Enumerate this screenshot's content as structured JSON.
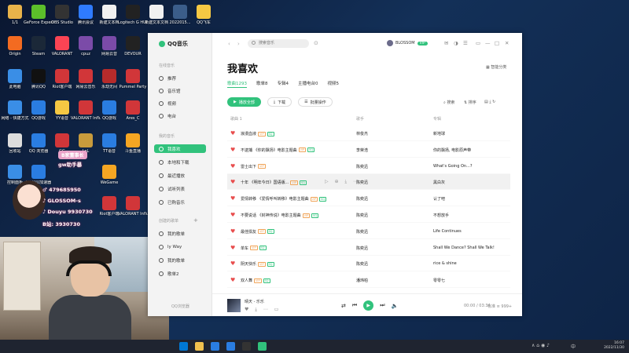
{
  "desktop": {
    "icons": [
      {
        "label": "1/1",
        "color": "#e8b34a"
      },
      {
        "label": "GeForce Experience",
        "color": "#5cbf2a"
      },
      {
        "label": "OBS Studio",
        "color": "#333333"
      },
      {
        "label": "腾讯会议",
        "color": "#2f7bff"
      },
      {
        "label": "新建文本档",
        "color": "#f0f0f0"
      },
      {
        "label": "Logitech G HUB",
        "color": "#222222"
      },
      {
        "label": "新建文本文档",
        "color": "#f0f0f0"
      },
      {
        "label": "2022015...",
        "color": "#3b5d8a"
      },
      {
        "label": "QQ飞车",
        "color": "#f5c843"
      },
      {
        "label": "Origin",
        "color": "#f36b21"
      },
      {
        "label": "Steam",
        "color": "#1b2838"
      },
      {
        "label": "VALORANT",
        "color": "#fa4454"
      },
      {
        "label": "cpuz",
        "color": "#7b4ba8"
      },
      {
        "label": "网易云音",
        "color": "#7b4ba8"
      },
      {
        "label": "DEVOUR",
        "color": "#222222"
      },
      {
        "label": "此电脑",
        "color": "#3a8ee6"
      },
      {
        "label": "腾讯QQ",
        "color": "#111111"
      },
      {
        "label": "Riot客户端",
        "color": "#d13639"
      },
      {
        "label": "网易云音乐",
        "color": "#d13639"
      },
      {
        "label": "永劫无间",
        "color": "#b62b2b"
      },
      {
        "label": "Pummel Party",
        "color": "#d13639"
      },
      {
        "label": "网络 - 快捷方式",
        "color": "#3a8ee6"
      },
      {
        "label": "QQ游戏",
        "color": "#2a7de1"
      },
      {
        "label": "YY语音",
        "color": "#f5c843"
      },
      {
        "label": "VALORANT Influence...",
        "color": "#d13639"
      },
      {
        "label": "QQ游戏",
        "color": "#2a7de1"
      },
      {
        "label": "Ares_C",
        "color": "#d13639"
      },
      {
        "label": "回收站",
        "color": "#dddddd"
      },
      {
        "label": "QQ 浏览器",
        "color": "#2a7de1"
      },
      {
        "label": "GG",
        "color": "#d13639"
      },
      {
        "label": "LoL",
        "color": "#c89b3c"
      },
      {
        "label": "TT语音",
        "color": "#2a7de1"
      },
      {
        "label": "斗鱼直播",
        "color": "#f5a623"
      },
      {
        "label": "控制面板",
        "color": "#3a8ee6"
      },
      {
        "label": "网易UU加速器",
        "color": "#2a7de1"
      },
      {
        "label": "WeGame",
        "color": "#f5a623"
      },
      {
        "label": "Riot客户端",
        "color": "#d13639"
      },
      {
        "label": "VALORANT Influence...",
        "color": "#d13639"
      }
    ]
  },
  "overlay": {
    "badge": "B家董事长",
    "sub": "gw助手暴",
    "line1": "♂ 479685950",
    "line2": "♪ GLOSSOM-s",
    "line3": "♪ Douyu 9930730",
    "line4": "B站: 3930730"
  },
  "taskbar": {
    "time": "16:07",
    "date": "2022/11/30",
    "lang": "中",
    "tray": "∧ ⌂ ◉ ♪"
  },
  "app": {
    "name": "QQ音乐",
    "search_placeholder": "搜索音乐",
    "username": "BLOSSOM",
    "vip_label": "VIP",
    "sidebar": {
      "online_label": "在线音乐",
      "online": [
        {
          "label": "推荐",
          "icon": "circle-icon"
        },
        {
          "label": "音乐馆",
          "icon": "music-hall-icon"
        },
        {
          "label": "视频",
          "icon": "video-icon"
        },
        {
          "label": "电台",
          "icon": "radio-icon"
        }
      ],
      "my_label": "我的音乐",
      "my": [
        {
          "label": "我喜欢",
          "icon": "heart-icon",
          "active": true
        },
        {
          "label": "本地和下载",
          "icon": "download-icon"
        },
        {
          "label": "最近播放",
          "icon": "clock-icon"
        },
        {
          "label": "试听列表",
          "icon": "list-icon"
        },
        {
          "label": "已购音乐",
          "icon": "bag-icon"
        }
      ],
      "created_label": "创建的歌单",
      "playlists": [
        "我的歌单",
        "ly Way",
        "我的歌单",
        "歌单2"
      ],
      "extra_label": "QQ浏览器"
    },
    "page_title": "我喜欢",
    "tabs": [
      {
        "label": "歌曲1293",
        "active": true
      },
      {
        "label": "歌单8",
        "active": false
      },
      {
        "label": "专辑4",
        "active": false
      },
      {
        "label": "主播电台0",
        "active": false
      },
      {
        "label": "视频5",
        "active": false
      }
    ],
    "actions": {
      "play_all": "播放全部",
      "download": "下载",
      "batch": "批量操作",
      "search": "搜索",
      "sort": "排序"
    },
    "columns": {
      "song": "歌曲 1",
      "singer": "歌手",
      "album": "专辑"
    },
    "songs": [
      {
        "title": "浪漫血液",
        "tags": [
          "VIP",
          "SQ"
        ],
        "singer": "林俊杰",
        "album": "新地球"
      },
      {
        "title": "不逮捕 《你的飘扬》电影主题曲",
        "tags": [
          "VIP",
          "SQ"
        ],
        "singer": "李荣浩",
        "album": "你的飘扬, 电影原声带"
      },
      {
        "title": "雷士出下",
        "tags": [
          "VIP"
        ],
        "singer": "陈奕迅",
        "album": "What's Going On...?"
      },
      {
        "title": "十年 《明年今日》国语版...",
        "tags": [
          "VIP",
          "SQ"
        ],
        "singer": "陈奕迅",
        "album": "黑白灰",
        "hover": true
      },
      {
        "title": "爱情转移 《爱情呼叫转移》电影主题曲",
        "tags": [
          "VIP",
          "SQ"
        ],
        "singer": "陈奕迅",
        "album": "认了吧"
      },
      {
        "title": "不要说话 《封神传说》电影主题曲",
        "tags": [
          "VIP",
          "SQ"
        ],
        "singer": "陈奕迅",
        "album": "不想放手"
      },
      {
        "title": "最佳损友",
        "tags": [
          "VIP",
          "SQ"
        ],
        "singer": "陈奕迅",
        "album": "Life Continues"
      },
      {
        "title": "单车",
        "tags": [
          "VIP",
          "SQ"
        ],
        "singer": "陈奕迅",
        "album": "Shall We Dance? Shall We Talk!"
      },
      {
        "title": "阴天快乐",
        "tags": [
          "VIP",
          "SQ"
        ],
        "singer": "陈奕迅",
        "album": "rice & shine"
      },
      {
        "title": "双人舞",
        "tags": [
          "VIP",
          "SQ"
        ],
        "singer": "潘玮柏",
        "album": "零零七"
      }
    ],
    "player": {
      "title": "晴天 - 乐乐",
      "time": "00:00 / 03:34",
      "quality": "标准",
      "count": "999+"
    }
  }
}
